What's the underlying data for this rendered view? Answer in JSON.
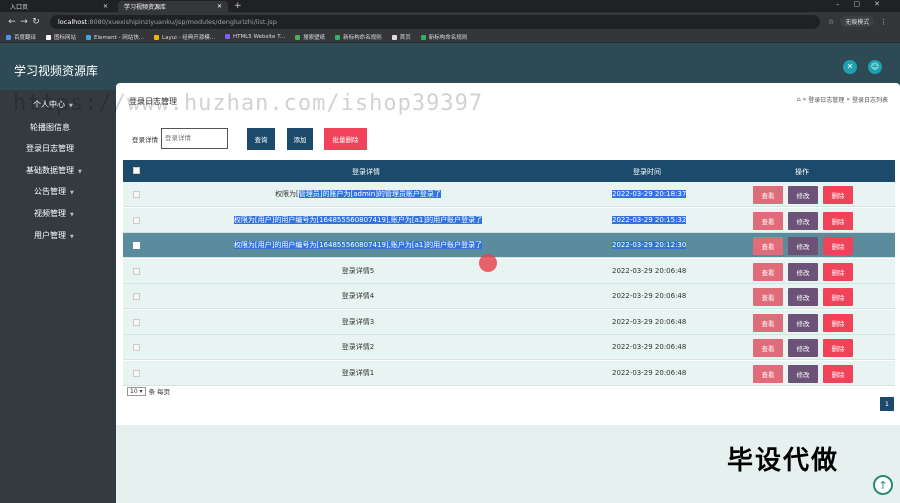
{
  "browser": {
    "tabs": [
      {
        "label": "入口页",
        "active": false
      },
      {
        "label": "学习视频资源库",
        "active": true
      }
    ],
    "url_host": "localhost",
    "url_rest": ":8080/xuexishipinziyuanku/jsp/modules/denglurizhi/list.jsp",
    "guest_label": "无痕模式",
    "bookmarks": [
      "百度翻译",
      "图标网站",
      "Element - 网站快...",
      "Layui - 经典开源模...",
      "HTML5 Website T...",
      "搜索壁纸",
      "新标构命名规则",
      "首页",
      "新标构命名规则"
    ]
  },
  "app": {
    "title": "学习视频资源库",
    "icons": [
      "tools-icon",
      "user-icon"
    ]
  },
  "watermark": "https://www.huzhan.com/ishop39397",
  "sidebar": {
    "items": [
      {
        "label": "个人中心",
        "caret": true
      },
      {
        "label": "轮播图信息",
        "caret": false
      },
      {
        "label": "登录日志管理",
        "caret": false
      },
      {
        "label": "基础数据管理",
        "caret": true
      },
      {
        "label": "公告管理",
        "caret": true
      },
      {
        "label": "视频管理",
        "caret": true
      },
      {
        "label": "用户管理",
        "caret": true
      }
    ]
  },
  "page": {
    "heading": "登录日志管理",
    "breadcrumb": [
      "登录日志管理",
      "登录日志列表"
    ],
    "search_label": "登录详情",
    "search_placeholder": "登录详情",
    "btn_search": "查询",
    "btn_add": "添加",
    "btn_batch_delete": "批量删除"
  },
  "table": {
    "headers": {
      "detail": "登录详情",
      "time": "登录时间",
      "actions": "操作"
    },
    "action_labels": {
      "view": "查看",
      "edit": "修改",
      "delete": "删除"
    },
    "rows": [
      {
        "pre": "权限为[",
        "detail": "管理员]的账户为[admin]的管理员账户登录了",
        "time": "2022-03-29 20:18:37",
        "highlight": true,
        "selected": false
      },
      {
        "pre": "",
        "detail": "权限为[用户]的用户编号为[1648555608074​19],账户为[a1]的用户账户登录了",
        "time": "2022-03-29 20:15:32",
        "highlight": true,
        "selected": false
      },
      {
        "pre": "",
        "detail": "权限为[用户]的用户编号为[164855560807419],账户为[a1]的用户账户登录了",
        "time": "2022-03-29 20:12:30",
        "highlight": true,
        "selected": true
      },
      {
        "pre": "",
        "detail": "登录详情5",
        "time": "2022-03-29 20:06:48",
        "highlight": false,
        "selected": false
      },
      {
        "pre": "",
        "detail": "登录详情4",
        "time": "2022-03-29 20:06:48",
        "highlight": false,
        "selected": false
      },
      {
        "pre": "",
        "detail": "登录详情3",
        "time": "2022-03-29 20:06:48",
        "highlight": false,
        "selected": false
      },
      {
        "pre": "",
        "detail": "登录详情2",
        "time": "2022-03-29 20:06:48",
        "highlight": false,
        "selected": false
      },
      {
        "pre": "",
        "detail": "登录详情1",
        "time": "2022-03-29 20:06:48",
        "highlight": false,
        "selected": false
      }
    ]
  },
  "pager": {
    "page_size": "10",
    "per_page_label": "条 每页",
    "current_page": "1"
  },
  "promo_text": "毕设代做",
  "colors": {
    "header": "#2e4a55",
    "sidebar": "#333a40",
    "table_head": "#1b4a6b",
    "highlight": "#3273e0"
  }
}
